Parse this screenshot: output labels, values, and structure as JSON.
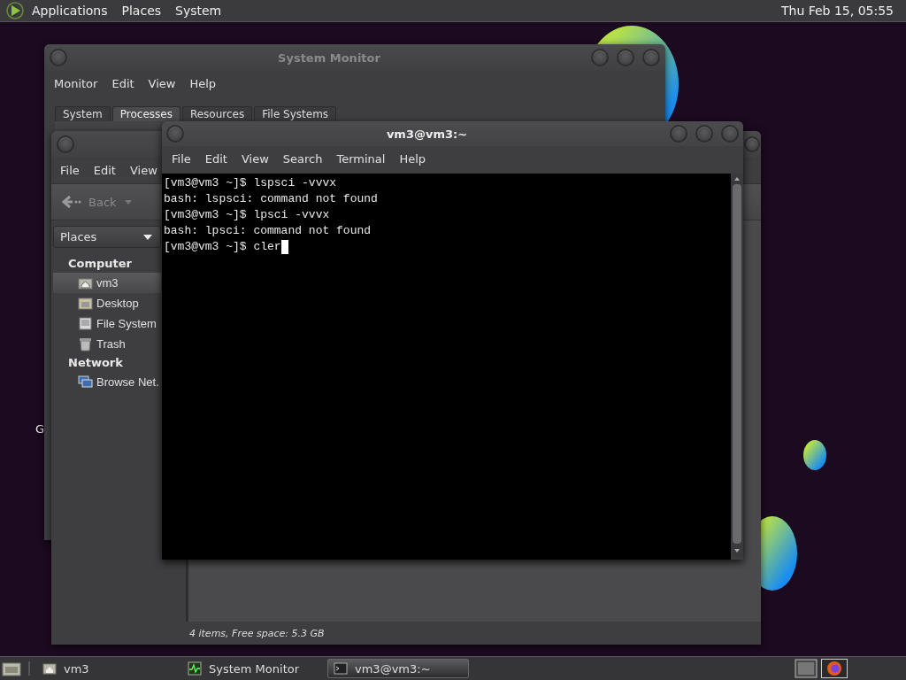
{
  "top_panel": {
    "menus": [
      "Applications",
      "Places",
      "System"
    ],
    "clock": "Thu Feb 15, 05:55"
  },
  "desktop": {
    "icon_label": "G"
  },
  "system_monitor": {
    "title": "System Monitor",
    "menus": [
      "Monitor",
      "Edit",
      "View",
      "Help"
    ],
    "tabs": [
      {
        "label": "System",
        "selected": false
      },
      {
        "label": "Processes",
        "selected": true
      },
      {
        "label": "Resources",
        "selected": false
      },
      {
        "label": "File Systems",
        "selected": false
      }
    ]
  },
  "file_manager": {
    "menus": [
      "File",
      "Edit",
      "View"
    ],
    "back": "Back",
    "places_dropdown": "Places",
    "sidebar": [
      {
        "heading": "Computer",
        "items": [
          {
            "label": "vm3",
            "selected": true
          },
          {
            "label": "Desktop",
            "selected": false
          },
          {
            "label": "File System",
            "selected": false
          },
          {
            "label": "Trash",
            "selected": false
          }
        ]
      },
      {
        "heading": "Network",
        "items": [
          {
            "label": "Browse Net.",
            "selected": false
          }
        ]
      }
    ],
    "status": "4 items, Free space: 5.3 GB"
  },
  "terminal": {
    "title": "vm3@vm3:~",
    "menus": [
      "File",
      "Edit",
      "View",
      "Search",
      "Terminal",
      "Help"
    ],
    "lines": [
      "[vm3@vm3 ~]$ lspsci -vvvx",
      "bash: lspsci: command not found",
      "[vm3@vm3 ~]$ lpsci -vvvx",
      "bash: lpsci: command not found",
      "[vm3@vm3 ~]$ cler"
    ]
  },
  "taskbar": {
    "windows": [
      {
        "label": "vm3",
        "selected": false
      },
      {
        "label": "System Monitor",
        "selected": false
      },
      {
        "label": "vm3@vm3:~",
        "selected": true
      }
    ]
  }
}
